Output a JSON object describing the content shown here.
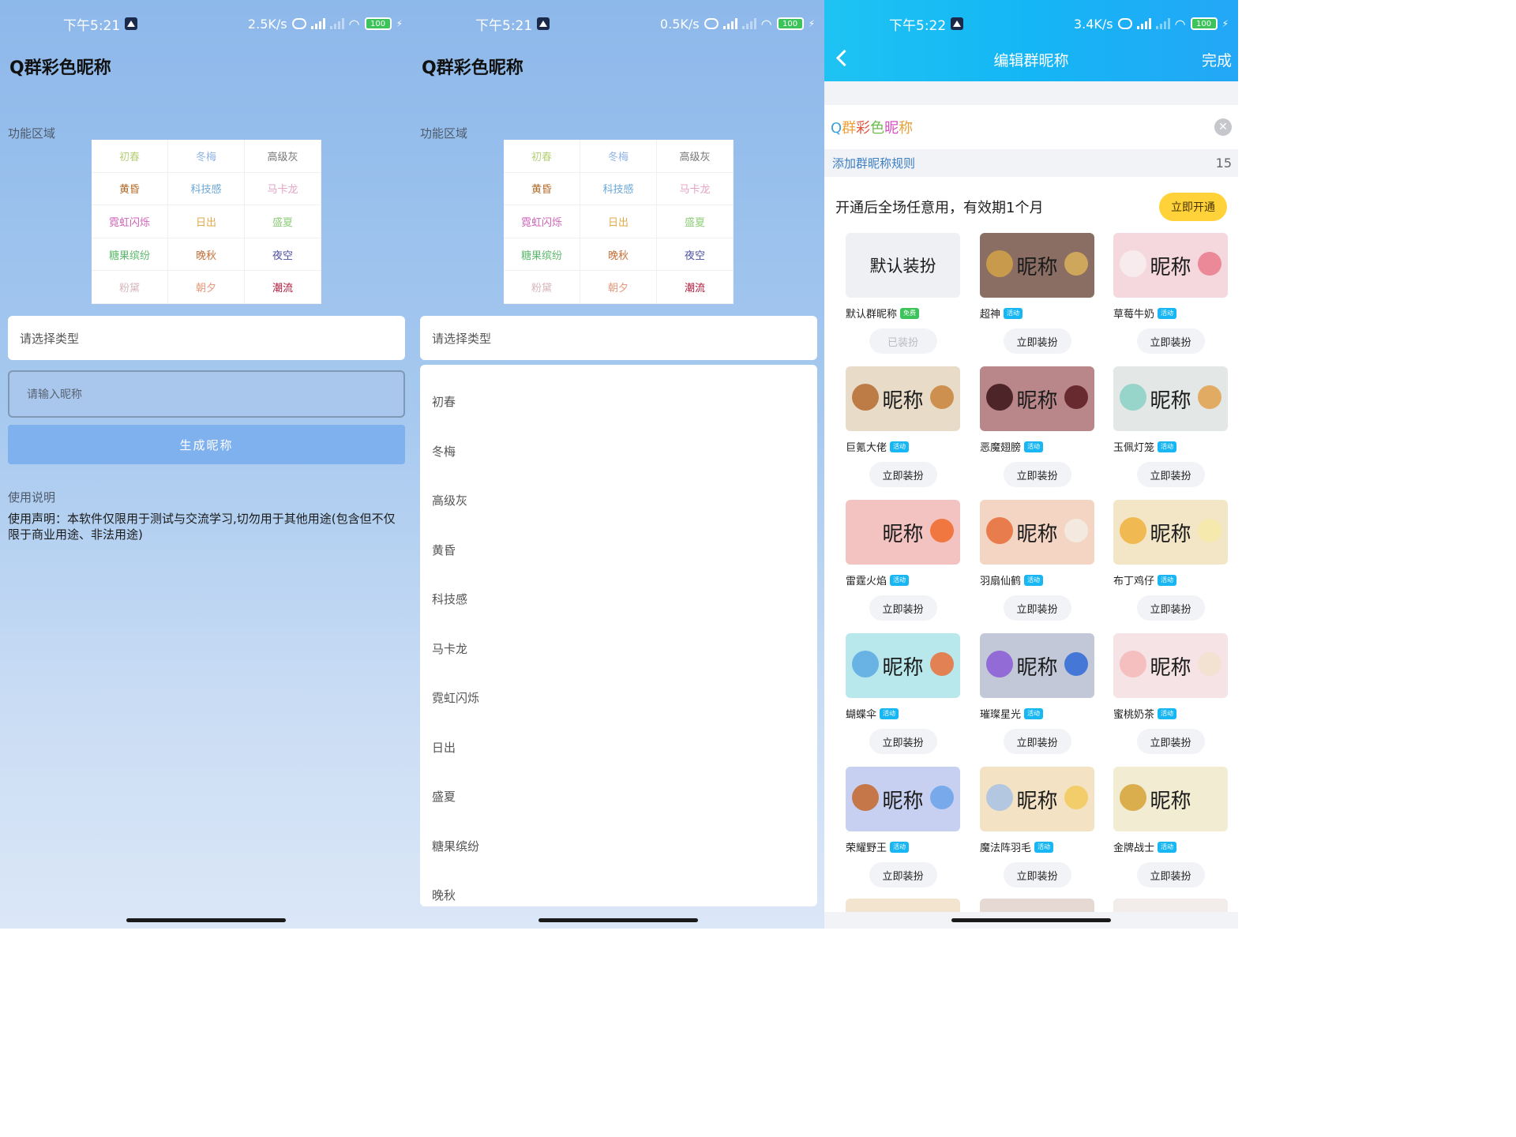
{
  "status": {
    "time1": "下午5:21",
    "speed1": "2.5K/s",
    "time2": "下午5:21",
    "speed2": "0.5K/s",
    "time3": "下午5:22",
    "speed3": "3.4K/s",
    "battery": "100"
  },
  "app": {
    "title": "Q群彩色昵称",
    "section_label": "功能区域",
    "styles": [
      {
        "label": "初春",
        "color": "#b8cf7a"
      },
      {
        "label": "冬梅",
        "color": "#8fb4e6"
      },
      {
        "label": "高级灰",
        "color": "#777777"
      },
      {
        "label": "黄昏",
        "color": "#b36a2a"
      },
      {
        "label": "科技感",
        "color": "#6aa7d8"
      },
      {
        "label": "马卡龙",
        "color": "#e3a3c6"
      },
      {
        "label": "霓虹闪烁",
        "color": "#d062b8"
      },
      {
        "label": "日出",
        "color": "#e1a94a"
      },
      {
        "label": "盛夏",
        "color": "#8fce7a"
      },
      {
        "label": "糖果缤纷",
        "color": "#5eb86e"
      },
      {
        "label": "晚秋",
        "color": "#c4713a"
      },
      {
        "label": "夜空",
        "color": "#4b4fa0"
      },
      {
        "label": "粉黛",
        "color": "#d7b7bd"
      },
      {
        "label": "朝夕",
        "color": "#e59a7d"
      },
      {
        "label": "潮流",
        "color": "#b3173a"
      }
    ],
    "select_placeholder": "请选择类型",
    "input_placeholder": "请输入昵称",
    "generate_label": "生成昵称",
    "usage_title": "使用说明",
    "usage_text": "使用声明：本软件仅限用于测试与交流学习,切勿用于其他用途(包含但不仅限于商业用途、非法用途)"
  },
  "dropdown": {
    "options": [
      "初春",
      "冬梅",
      "高级灰",
      "黄昏",
      "科技感",
      "马卡龙",
      "霓虹闪烁",
      "日出",
      "盛夏",
      "糖果缤纷",
      "晚秋"
    ]
  },
  "editor": {
    "nav_title": "编辑群昵称",
    "done_label": "完成",
    "nickname_value": "Q群彩色昵称",
    "rules_link": "添加群昵称规则",
    "rules_count": "15",
    "promo_text": "开通后全场任意用，有效期1个月",
    "open_label": "立即开通",
    "wear_label": "立即装扮",
    "worn_label": "已装扮",
    "items": [
      {
        "name": "默认群昵称",
        "tag": "免费",
        "thumb_text": "默认装扮",
        "bg": "#eef0f3",
        "deco_l": "",
        "deco_r": "",
        "worn": true
      },
      {
        "name": "超神",
        "tag": "活动",
        "thumb_text": "昵称",
        "bg": "#8b6e63",
        "deco_l": "#d2a248",
        "deco_r": "#d9b25a",
        "worn": false
      },
      {
        "name": "草莓牛奶",
        "tag": "活动",
        "thumb_text": "昵称",
        "bg": "#f4d8de",
        "deco_l": "#f7eef0",
        "deco_r": "#e97b8c",
        "worn": false
      },
      {
        "name": "巨氪大佬",
        "tag": "活动",
        "thumb_text": "昵称",
        "bg": "#e8dcc9",
        "deco_l": "#b56b2f",
        "deco_r": "#c8833a",
        "worn": false
      },
      {
        "name": "恶魔翅膀",
        "tag": "活动",
        "thumb_text": "昵称",
        "bg": "#b9868a",
        "deco_l": "#3a1416",
        "deco_r": "#5a1a1f",
        "worn": false
      },
      {
        "name": "玉佩灯笼",
        "tag": "活动",
        "thumb_text": "昵称",
        "bg": "#e3e8e6",
        "deco_l": "#8ad0c3",
        "deco_r": "#e2a04c",
        "worn": false
      },
      {
        "name": "雷霆火焰",
        "tag": "活动",
        "thumb_text": "昵称",
        "bg": "#f3c3c1",
        "deco_l": "",
        "deco_r": "#f06a2a",
        "worn": false
      },
      {
        "name": "羽扇仙鹤",
        "tag": "活动",
        "thumb_text": "昵称",
        "bg": "#f4d4c2",
        "deco_l": "#e56c37",
        "deco_r": "#f2ece4",
        "worn": false
      },
      {
        "name": "布丁鸡仔",
        "tag": "活动",
        "thumb_text": "昵称",
        "bg": "#f2e6c6",
        "deco_l": "#f1b03c",
        "deco_r": "#f7e9a8",
        "worn": false
      },
      {
        "name": "蝴蝶伞",
        "tag": "活动",
        "thumb_text": "昵称",
        "bg": "#b8e8ec",
        "deco_l": "#5ba8e3",
        "deco_r": "#e9703a",
        "worn": false
      },
      {
        "name": "璀璨星光",
        "tag": "活动",
        "thumb_text": "昵称",
        "bg": "#c2c8d8",
        "deco_l": "#8b5bd6",
        "deco_r": "#2f6ad6",
        "worn": false
      },
      {
        "name": "蜜桃奶茶",
        "tag": "活动",
        "thumb_text": "昵称",
        "bg": "#f5e3e5",
        "deco_l": "#f4b7b8",
        "deco_r": "#f2e1cf",
        "worn": false
      },
      {
        "name": "荣耀野王",
        "tag": "活动",
        "thumb_text": "昵称",
        "bg": "#c8d0f1",
        "deco_l": "#c4672c",
        "deco_r": "#6aa3ea",
        "worn": false
      },
      {
        "name": "魔法阵羽毛",
        "tag": "活动",
        "thumb_text": "昵称",
        "bg": "#f3e3c4",
        "deco_l": "#a7c2e6",
        "deco_r": "#f2c95b",
        "worn": false
      },
      {
        "name": "金牌战士",
        "tag": "活动",
        "thumb_text": "昵称",
        "bg": "#f1ecd2",
        "deco_l": "#d6a236",
        "deco_r": "",
        "worn": false
      }
    ]
  }
}
